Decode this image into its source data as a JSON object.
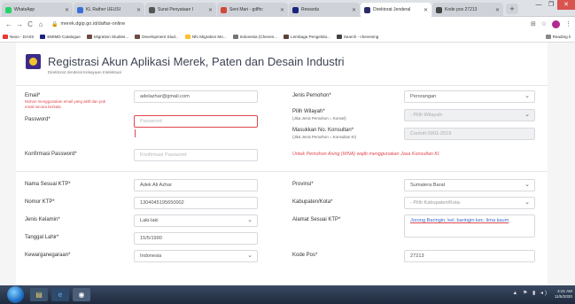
{
  "browser": {
    "tabs": [
      {
        "title": "WhatsApp",
        "color": "#25d366"
      },
      {
        "title": "KL Rather UEUSI",
        "color": "#3a6fd8"
      },
      {
        "title": "Surat Penyataan I",
        "color": "#555555"
      },
      {
        "title": "Seni Mari - gdfhc",
        "color": "#d14836"
      },
      {
        "title": "Rewarda",
        "color": "#1a237e"
      },
      {
        "title": "Direktorat Jenderal",
        "color": "#2b2b6b"
      },
      {
        "title": "Kode pos 27213",
        "color": "#444444"
      }
    ],
    "new_tab": "+",
    "window_controls": {
      "minimize": "—",
      "maximize": "❐",
      "close": "✕"
    },
    "nav": {
      "back": "←",
      "forward": "→",
      "reload": "C",
      "home": "⌂"
    },
    "url": "merek.dgip.go.id/daftar-online",
    "toolbar_icons": {
      "translate": "⊞",
      "star": "☆",
      "menu": "⋮"
    },
    "bookmarks": [
      {
        "label": "Nexo - DASS",
        "color": "#e53935"
      },
      {
        "label": "EMIMD Catalogue",
        "color": "#1a237e"
      },
      {
        "label": "Migration Studies...",
        "color": "#6d4c41"
      },
      {
        "label": "Development Stud...",
        "color": "#6d4c41"
      },
      {
        "label": "Nfo Migration Mo...",
        "color": "#fbc02d"
      },
      {
        "label": "Indonesia (Cheven...",
        "color": "#757575"
      },
      {
        "label": "Lembaga Pengelola...",
        "color": "#5d4037"
      },
      {
        "label": "Search - chevening",
        "color": "#424242"
      }
    ],
    "reading_list": "Reading li"
  },
  "header": {
    "title": "Registrasi Akun Aplikasi Merek, Paten dan Desain Industri",
    "subtitle": "Direktorat Jenderal Kekayaan Intelektual"
  },
  "form": {
    "email": {
      "label": "Email*",
      "value": "adelazhar@gmail.com",
      "hint": "Mohon menggunakan email yang aktif dan pok email secara berkala"
    },
    "password": {
      "label": "Password*",
      "placeholder": "Password"
    },
    "confirm_password": {
      "label": "Konfirmasi Password*",
      "placeholder": "Konfirmasi Password"
    },
    "jenis_pemohon": {
      "label": "Jenis Pemohon*",
      "value": "Perorangan"
    },
    "pilih_wilayah": {
      "label": "Pilih Wilayah*",
      "sub": "(Jika Jenis Pemohon = Konsel)",
      "placeholder": "- Pilih Wilayah-"
    },
    "konsultan": {
      "label": "Masukkan No. Konsultan*",
      "sub": "(Jika Jenis Pemohon = Konsultan KI)",
      "placeholder": "Contoh:0001-2019"
    },
    "warning": "Untuk Pemohon Asing (WNA) wajib menggunakan Jasa Konsultan KI.",
    "nama_ktp": {
      "label": "Nama Sesuai KTP*",
      "value": "Adek Ali Azhar"
    },
    "nomor_ktp": {
      "label": "Nomor KTP*",
      "value": "1304045195650002"
    },
    "jenis_kelamin": {
      "label": "Jenis Kelamin*",
      "value": "Laki-laki"
    },
    "tanggal_lahir": {
      "label": "Tanggal Lahir*",
      "value": "15/5/1990"
    },
    "kewarganegaraan": {
      "label": "Kewarganegaraan*",
      "value": "Indonesia"
    },
    "provinsi": {
      "label": "Provinsi*",
      "value": "Sumatera Barat"
    },
    "kabupaten": {
      "label": "Kabupaten/Kota*",
      "placeholder": "- Pilih Kabupaten/Kota-"
    },
    "alamat": {
      "label": "Alamat Sesuai KTP*",
      "value": "Jorong Baringin, kel. baringin kec. lima kaum"
    },
    "kode_pos": {
      "label": "Kode Pos*",
      "value": "27213"
    }
  },
  "taskbar": {
    "tray": "▲ ⚑ ▮ ◂)",
    "time": "4:21 AM",
    "date": "11/5/2020"
  }
}
